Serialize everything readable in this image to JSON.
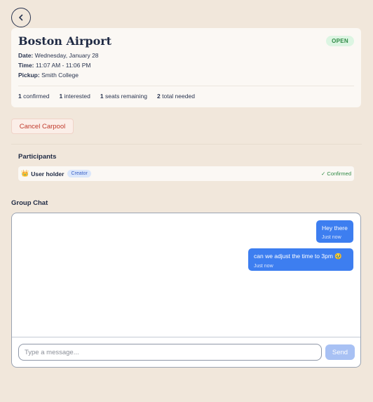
{
  "header": {
    "back_icon": "chevron-left-icon"
  },
  "trip": {
    "title": "Boston Airport",
    "status": "OPEN",
    "date_label": "Date:",
    "date_value": "Wednesday, January 28",
    "time_label": "Time:",
    "time_value": "11:07 AM - 11:06 PM",
    "pickup_label": "Pickup:",
    "pickup_value": "Smith College",
    "stats": [
      {
        "count": "1",
        "label": "confirmed"
      },
      {
        "count": "1",
        "label": "interested"
      },
      {
        "count": "1",
        "label": "seats remaining"
      },
      {
        "count": "2",
        "label": "total needed"
      }
    ]
  },
  "actions": {
    "cancel_label": "Cancel Carpool"
  },
  "participants": {
    "title": "Participants",
    "items": [
      {
        "icon": "crown-icon",
        "name": "User holder",
        "role": "Creator",
        "status": "✓ Confirmed"
      }
    ]
  },
  "chat": {
    "title": "Group Chat",
    "messages": [
      {
        "text": "Hey there",
        "time": "Just now"
      },
      {
        "text": "can we adjust the time to 3pm 🥹",
        "time": "Just now"
      }
    ],
    "input_placeholder": "Type a message...",
    "send_label": "Send"
  },
  "colors": {
    "background": "#f1e7db",
    "accent": "#3d7ef0",
    "open_green": "#2f8a45",
    "cancel_red": "#c0392b"
  }
}
